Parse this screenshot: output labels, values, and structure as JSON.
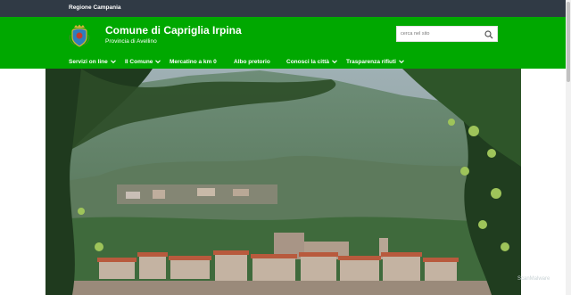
{
  "topbar": {
    "region": "Regione Campania"
  },
  "header": {
    "title": "Comune di Capriglia Irpina",
    "subtitle": "Provincia di Avellino",
    "logo_icon": "coat-of-arms-icon"
  },
  "search": {
    "placeholder": "cerca nel sito",
    "icon": "search-icon"
  },
  "nav": {
    "items": [
      {
        "label": "Servizi on line",
        "has_dropdown": true
      },
      {
        "label": "Il Comune",
        "has_dropdown": true
      },
      {
        "label": "Mercatino a km 0",
        "has_dropdown": false
      },
      {
        "label": "Albo pretorio",
        "has_dropdown": false
      },
      {
        "label": "Conosci la città",
        "has_dropdown": true
      },
      {
        "label": "Trasparenza rifiuti",
        "has_dropdown": true
      }
    ]
  },
  "hero": {
    "image": "photo of the town in front of mountains, framed by chestnut branches"
  },
  "watermark": "ScanMalware",
  "colors": {
    "topbar": "#303a45",
    "header": "#00a800",
    "text": "#ffffff"
  }
}
